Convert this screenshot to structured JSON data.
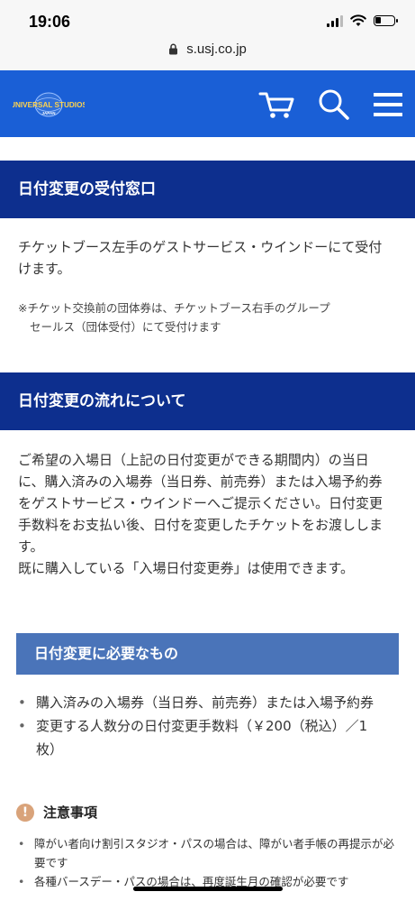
{
  "status": {
    "time": "19:06"
  },
  "browser": {
    "url": "s.usj.co.jp"
  },
  "header": {
    "logo_line1": "UNIVERSAL STUDIOS",
    "logo_line2": "JAPAN",
    "colors": {
      "bar": "#1a5fd6",
      "section": "#0d2f8e",
      "subsection": "#4a74b9"
    },
    "icons": [
      "cart-icon",
      "search-icon",
      "menu-icon"
    ]
  },
  "section1": {
    "title": "日付変更の受付窓口",
    "body": "チケットブース左手のゲストサービス・ウインドーにて受付けます。",
    "note_line1": "※チケット交換前の団体券は、チケットブース右手のグループ",
    "note_line2": "セールス（団体受付）にて受付けます"
  },
  "section2": {
    "title": "日付変更の流れについて",
    "body1": "ご希望の入場日（上記の日付変更ができる期間内）の当日に、購入済みの入場券（当日券、前売券）または入場予約券をゲストサービス・ウインドーへご提示ください。日付変更手数料をお支払い後、日付を変更したチケットをお渡しします。",
    "body2": "既に購入している「入場日付変更券」は使用できます。"
  },
  "required": {
    "title": "日付変更に必要なもの",
    "items": [
      "購入済みの入場券（当日券、前売券）または入場予約券",
      "変更する人数分の日付変更手数料（￥200（税込）／1枚）"
    ]
  },
  "caution": {
    "title": "注意事項",
    "items": [
      "障がい者向け割引スタジオ・パスの場合は、障がい者手帳の再提示が必要です",
      "各種バースデー・パスの場合は、再度誕生月の確認が必要です"
    ]
  }
}
